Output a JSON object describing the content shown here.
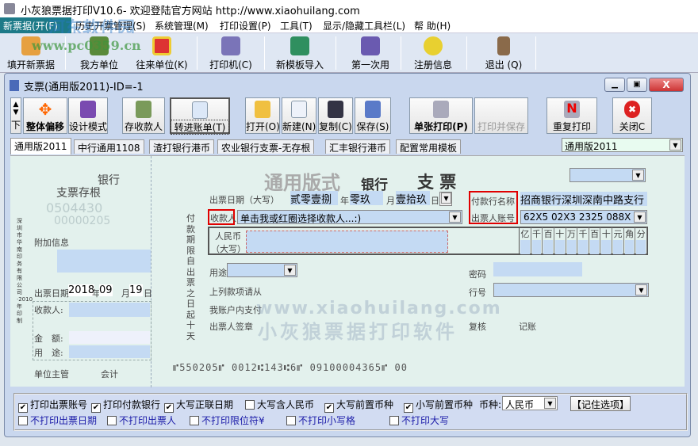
{
  "app": {
    "title": "小灰狼票据打印V10.6- 欢迎登陆官方网站 http://www.xiaohuilang.com"
  },
  "menu": [
    "新票据(开(F)",
    "历史开票管理(S)",
    "系统管理(M)",
    "打印设置(P)",
    "工具(T)",
    "显示/隐藏工具栏(L)",
    "帮 助(H)"
  ],
  "toolbar": [
    "填开新票据",
    "我方单位",
    "往来单位(K)",
    "打印机(C)",
    "新模板导入",
    "第一次用",
    "注册信息",
    "退出 (Q)"
  ],
  "watermark": {
    "site": "www.pc0359.cn",
    "brand": "河东软件园"
  },
  "child": {
    "title": "支票(通用版2011)-ID=-1",
    "buttons": [
      "下",
      "整体偏移",
      "设计模式",
      "存收款人",
      "转进账单(T)",
      "打开(O)",
      "新建(N)",
      "复制(C)",
      "保存(S)",
      "单张打印(P)",
      "打印并保存",
      "重复打印",
      "关闭C"
    ],
    "tabs": [
      "通用版2011",
      "中行通用1108",
      "渣打银行港币",
      "农业银行支票-无存根",
      "汇丰银行港币",
      "配置常用模板"
    ],
    "template_select": "通用版2011"
  },
  "stub": {
    "bank": "银行",
    "title": "支票存根",
    "serial1": "0504430",
    "serial2": "00000205",
    "side_text": "深圳市华南印务有限公司·2010年印制",
    "extra_label": "附加信息",
    "date_label": "出票日期",
    "year": "2018",
    "y": "年",
    "month": "09",
    "m": "月",
    "day": "19",
    "d": "日",
    "payee_label": "收款人:",
    "amount_label": "金　额:",
    "use_label": "用　途:",
    "manager": "单位主管",
    "accountant": "会计"
  },
  "cheque": {
    "title_big": "通用版式",
    "title_bank": "银行",
    "title_cheque": "支 票",
    "date_label": "出票日期（大写）",
    "year_val": "贰零壹捌",
    "year": "年",
    "month_val": "零玖",
    "month": "月",
    "day_val": "壹拾玖",
    "day": "日",
    "payee_label": "收款人",
    "payee_value": "单击我或红圈选择收款人...:)",
    "payer_bank_label": "付款行名称",
    "payer_bank_value": "招商银行深圳深南中路支行",
    "account_label": "出票人账号",
    "account_value": "62X5 02X3 2325 088X",
    "rmb_label1": "人民币",
    "rmb_label2": "（大写）",
    "digits": [
      "亿",
      "千",
      "百",
      "十",
      "万",
      "千",
      "百",
      "十",
      "元",
      "角",
      "分"
    ],
    "side_text": "付款期限自出票之日起十天",
    "use_label": "用途",
    "password_label": "密码",
    "bank_no_label": "行号",
    "line1": "上列款项请从",
    "line2": "我账户内支付",
    "signature": "出票人签章",
    "review": "复核",
    "bookkeep": "记账",
    "micr": "⑈550205⑈ 0012⑆143⑆6⑈ 09100004365⑈ 00",
    "wm1": "www.xiaohuilang.com",
    "wm2": "小灰狼票据打印软件"
  },
  "options": {
    "row1": [
      {
        "label": "打印出票账号",
        "checked": true
      },
      {
        "label": "打印付款银行",
        "checked": true
      },
      {
        "label": "大写正联日期",
        "checked": true
      },
      {
        "label": "大写含人民币",
        "checked": false
      },
      {
        "label": "大写前置币种",
        "checked": true
      },
      {
        "label": "小写前置币种",
        "checked": true
      }
    ],
    "currency_label": "币种:",
    "currency": "人民币",
    "remember": "【记住选项】",
    "row2": [
      {
        "label": "不打印出票日期",
        "checked": false
      },
      {
        "label": "不打印出票人",
        "checked": false
      },
      {
        "label": "不打印限位符¥",
        "checked": false
      },
      {
        "label": "不打印小写格",
        "checked": false
      },
      {
        "label": "不打印大写",
        "checked": false
      }
    ]
  }
}
